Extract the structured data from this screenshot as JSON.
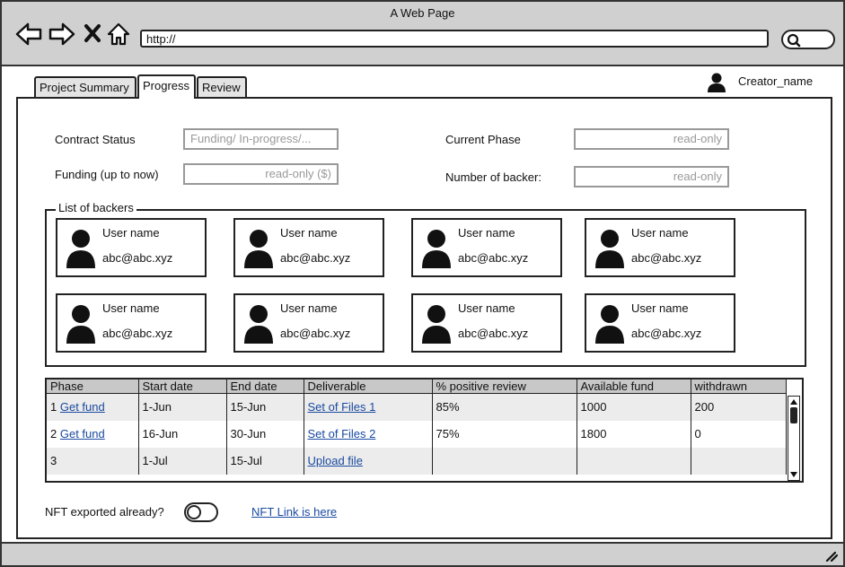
{
  "window": {
    "title": "A Web Page"
  },
  "browser": {
    "url": "http://",
    "icons": [
      "back-arrow-icon",
      "forward-arrow-icon",
      "close-x-icon",
      "home-icon",
      "search-icon"
    ]
  },
  "tabs": [
    {
      "label": "Project Summary",
      "active": false
    },
    {
      "label": "Progress",
      "active": true
    },
    {
      "label": "Review",
      "active": false
    }
  ],
  "user": {
    "name": "Creator_name"
  },
  "fields": {
    "contract_status": {
      "label": "Contract Status",
      "value": "Funding/ In-progress/..."
    },
    "funding": {
      "label": "Funding (up to now)",
      "value": "read-only ($)"
    },
    "current_phase": {
      "label": "Current Phase",
      "value": "read-only"
    },
    "number_of_backer": {
      "label": "Number of backer:",
      "value": "read-only"
    }
  },
  "backers": {
    "title": "List of backers",
    "items": [
      {
        "name": "User name",
        "email": "abc@abc.xyz"
      },
      {
        "name": "User name",
        "email": "abc@abc.xyz"
      },
      {
        "name": "User name",
        "email": "abc@abc.xyz"
      },
      {
        "name": "User name",
        "email": "abc@abc.xyz"
      },
      {
        "name": "User name",
        "email": "abc@abc.xyz"
      },
      {
        "name": "User name",
        "email": "abc@abc.xyz"
      },
      {
        "name": "User name",
        "email": "abc@abc.xyz"
      },
      {
        "name": "User name",
        "email": "abc@abc.xyz"
      }
    ]
  },
  "table": {
    "columns": [
      "Phase",
      "Start date",
      "End date",
      "Deliverable",
      "% positive review",
      "Available fund",
      "withdrawn"
    ],
    "rows": [
      {
        "phase_num": "1",
        "phase_link": "Get fund",
        "start": "1-Jun",
        "end": "15-Jun",
        "deliverable": "Set of Files 1",
        "review": "85%",
        "fund": "1000",
        "withdrawn": "200"
      },
      {
        "phase_num": "2",
        "phase_link": "Get fund",
        "start": "16-Jun",
        "end": "30-Jun",
        "deliverable": "Set of Files 2",
        "review": "75%",
        "fund": "1800",
        "withdrawn": "0"
      },
      {
        "phase_num": "3",
        "phase_link": "",
        "start": "1-Jul",
        "end": "15-Jul",
        "deliverable": "Upload file",
        "review": "",
        "fund": "",
        "withdrawn": ""
      }
    ]
  },
  "nft": {
    "label": "NFT exported already?",
    "toggle_on": false,
    "link": "NFT Link is here"
  }
}
